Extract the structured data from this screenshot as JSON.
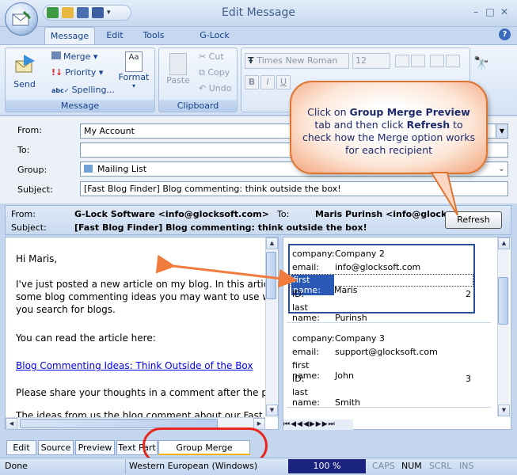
{
  "window": {
    "title": "Edit Message"
  },
  "ribbon_tabs": [
    "Message",
    "Edit",
    "Tools",
    "G-Lock Analytics"
  ],
  "ribbon": {
    "message_group": {
      "label": "Message",
      "send": "Send",
      "merge": "Merge",
      "priority": "Priority",
      "spelling": "Spelling...",
      "format": "Format"
    },
    "clipboard_group": {
      "label": "Clipboard",
      "paste": "Paste",
      "cut": "Cut",
      "copy": "Copy",
      "undo": "Undo"
    },
    "font": {
      "name": "Times New Roman",
      "size": "12"
    }
  },
  "form": {
    "from_label": "From:",
    "from_value": "My Account",
    "to_label": "To:",
    "to_value": "",
    "group_label": "Group:",
    "group_value": "Mailing List",
    "subject_label": "Subject:",
    "subject_value": "[Fast Blog Finder] Blog commenting: think outside the box!"
  },
  "preview_header": {
    "from_label": "From:",
    "from_value": "G-Lock Software <info@glocksoft.com>",
    "to_label": "To:",
    "to_value": "Maris Purinsh <info@glocksoft.c",
    "subject_label": "Subject:",
    "subject_value": "[Fast Blog Finder] Blog commenting: think outside the box!",
    "refresh": "Refresh"
  },
  "body": {
    "greeting": "Hi Maris,",
    "p1_line1": "I've just posted a new article on my blog. In this article",
    "p1_line2": "some blog commenting ideas you may want to use wh",
    "p1_line3": "you search for blogs.",
    "p2": "You can read the article here:",
    "link": "Blog Commenting Ideas: Think Outside of the Box",
    "p3": "Please share your thoughts in a comment after the po",
    "p4": "The ideas from us the blog comment about our Fast B"
  },
  "recipients": [
    {
      "company": "Company 2",
      "email": "info@glocksoft.com",
      "first_name": "Maris",
      "id": "2",
      "last_name": "Purinsh"
    },
    {
      "company": "Company 3",
      "email": "support@glocksoft.com",
      "first_name": "John",
      "id": "3",
      "last_name": "Smith"
    }
  ],
  "recipient_labels": {
    "company": "company:",
    "email": "email:",
    "first_name": "first name:",
    "id": "ID:",
    "last_name": "last name:"
  },
  "bottom_tabs": [
    "Edit",
    "Source",
    "Preview",
    "Text Part",
    "Group Merge Preview"
  ],
  "status": {
    "state": "Done",
    "encoding": "Western European (Windows)",
    "zoom": "100 %",
    "caps": "CAPS",
    "num": "NUM",
    "scrl": "SCRL",
    "ins": "INS"
  },
  "callout": {
    "part1": "Click on ",
    "bold1": "Group Merge Preview",
    "part2": " tab and then click ",
    "bold2": "Refresh",
    "part3": " to check how the Merge option works for each recipient"
  },
  "colors": {
    "accent": "#15428b",
    "callout_border": "#e0742f",
    "highlight_ring": "#e8281e",
    "zoom_bg": "#1a237e"
  }
}
